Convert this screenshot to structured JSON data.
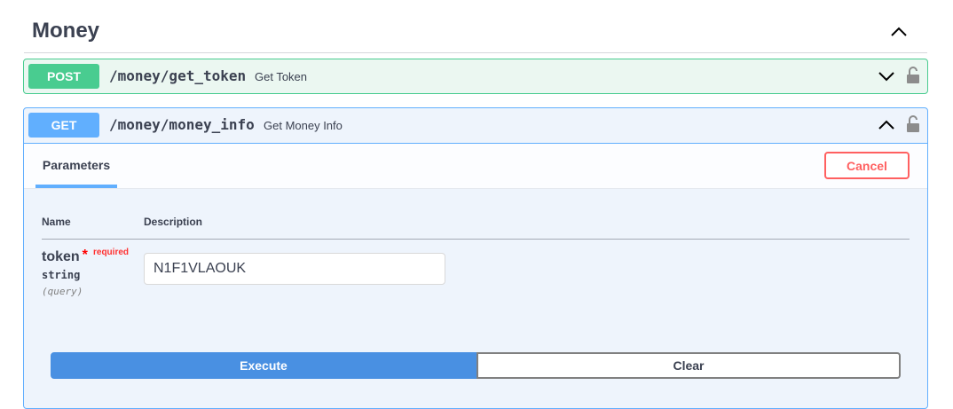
{
  "section": {
    "title": "Money",
    "toggle_icon": "chevron-up-icon"
  },
  "operations": [
    {
      "method": "POST",
      "path": "/money/get_token",
      "summary": "Get Token",
      "expanded": false,
      "color": "#49cc90"
    },
    {
      "method": "GET",
      "path": "/money/money_info",
      "summary": "Get Money Info",
      "expanded": true,
      "color": "#61affe"
    }
  ],
  "get_op": {
    "tab_label": "Parameters",
    "cancel_label": "Cancel",
    "table": {
      "col_name": "Name",
      "col_description": "Description"
    },
    "param": {
      "name": "token",
      "star": "*",
      "required_label": "required",
      "type": "string",
      "location": "(query)",
      "value": "N1F1VLAOUK"
    },
    "execute_label": "Execute",
    "clear_label": "Clear"
  },
  "colors": {
    "accent_execute": "#4990e2",
    "cancel": "#ff6060",
    "post": "#49cc90",
    "get": "#61affe"
  }
}
